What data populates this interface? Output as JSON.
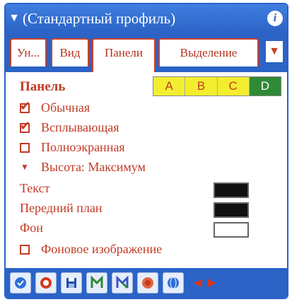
{
  "title": {
    "text": "(Стандартный профиль)",
    "arrow": "▼",
    "info_icon": "i"
  },
  "tabs": [
    {
      "label": "Ун..."
    },
    {
      "label": "Вид"
    },
    {
      "label": "Панели",
      "active": true
    },
    {
      "label": "Выделение"
    }
  ],
  "tab_more": "▼",
  "panel": {
    "heading": "Панель",
    "swatches": [
      {
        "label": "A",
        "color": "#f2ee2f",
        "text_color": "#c23a25"
      },
      {
        "label": "B",
        "color": "#f2ee2f",
        "text_color": "#c23a25"
      },
      {
        "label": "C",
        "color": "#f2ee2f",
        "text_color": "#c23a25"
      },
      {
        "label": "D",
        "color": "#2f8a35",
        "text_color": "#ffffff"
      }
    ],
    "options": [
      {
        "label": "Обычная",
        "checked": true
      },
      {
        "label": "Всплывающая",
        "checked": true
      },
      {
        "label": "Полноэкранная",
        "checked": false
      }
    ],
    "height_label": "Высота: Максимум",
    "colors": [
      {
        "label": "Текст",
        "value": "#111111"
      },
      {
        "label": "Передний план",
        "value": "#111111"
      },
      {
        "label": "Фон",
        "value": "#ffffff"
      }
    ],
    "bg_image": {
      "label": "Фоновое изображение",
      "checked": false
    }
  },
  "toolbar": {
    "icons": [
      "check-icon",
      "stop-icon",
      "save-icon",
      "export-icon",
      "import-icon",
      "record-icon",
      "globe-icon"
    ],
    "nav": [
      "◄",
      "►"
    ]
  }
}
